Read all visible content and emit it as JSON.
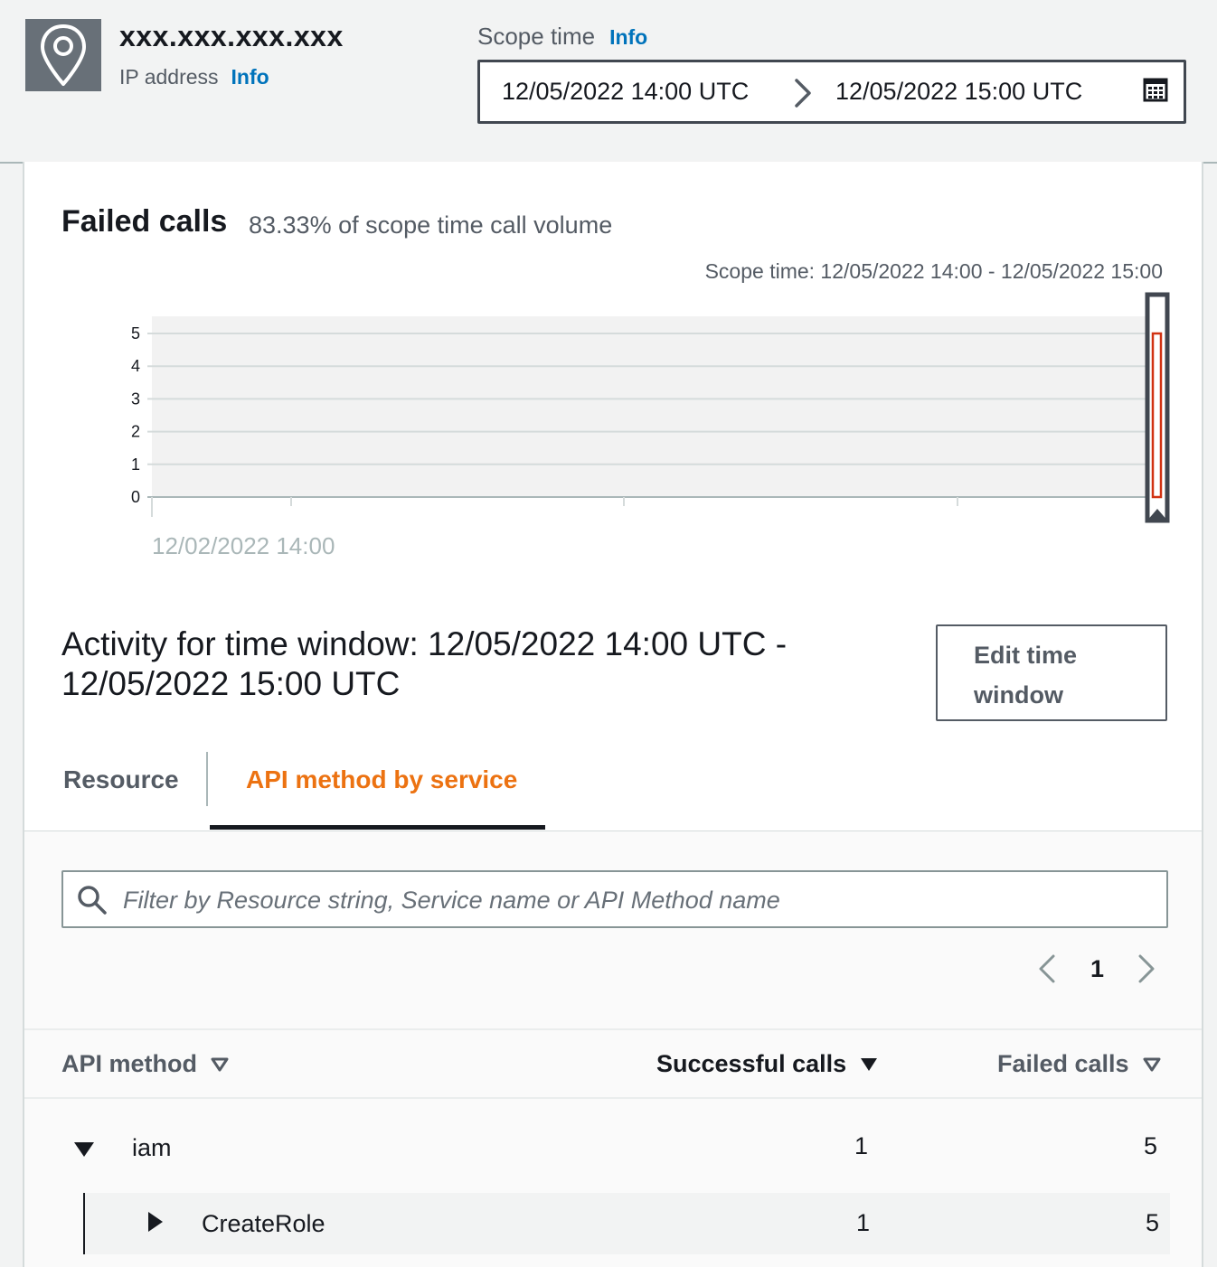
{
  "header": {
    "ip_value": "xxx.xxx.xxx.xxx",
    "ip_label": "IP address",
    "ip_info": "Info",
    "scope_label": "Scope time",
    "scope_info": "Info",
    "range_start": "12/05/2022 14:00 UTC",
    "range_end": "12/05/2022 15:00 UTC",
    "icons": {
      "location": "location-pin-icon",
      "arrow": "chevron-right-icon",
      "calendar": "calendar-icon"
    }
  },
  "failed_calls": {
    "title": "Failed calls",
    "subtitle": "83.33% of scope time call volume",
    "scope_caption": "Scope time: 12/05/2022 14:00 - 12/05/2022 15:00"
  },
  "chart_data": {
    "type": "bar",
    "title": "",
    "xlabel": "",
    "ylabel": "",
    "ylim": [
      0,
      5
    ],
    "yticks": [
      "0",
      "1",
      "2",
      "3",
      "4",
      "5"
    ],
    "xtick_labels": [
      "12/02/2022 14:00"
    ],
    "categories": [
      "12/05/2022 14:00"
    ],
    "values": [
      5
    ],
    "bar_color": "#d13212",
    "grid": true
  },
  "activity": {
    "title": "Activity for time window: 12/05/2022 14:00 UTC - 12/05/2022 15:00 UTC",
    "edit_button": "Edit time window"
  },
  "tabs": {
    "resource": "Resource",
    "api_method": "API method by service",
    "active": "API method by service"
  },
  "filter": {
    "placeholder": "Filter by Resource string, Service name or API Method name",
    "value": ""
  },
  "pagination": {
    "current_page": "1"
  },
  "table": {
    "columns": {
      "api_method": "API method",
      "successful": "Successful calls",
      "failed": "Failed calls"
    },
    "rows": [
      {
        "name": "iam",
        "successful": "1",
        "failed": "5",
        "expanded": true
      },
      {
        "name": "CreateRole",
        "successful": "1",
        "failed": "5",
        "expanded": false
      }
    ]
  },
  "colors": {
    "accent": "#ec7211",
    "link": "#0073bb",
    "failed_bar": "#d13212"
  }
}
